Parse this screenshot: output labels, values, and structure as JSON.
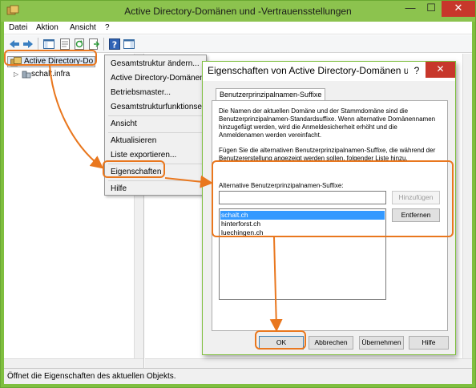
{
  "window": {
    "title": "Active Directory-Domänen und -Vertrauensstellungen",
    "min_glyph": "—",
    "max_glyph": "☐",
    "close_glyph": "✕"
  },
  "menubar": {
    "items": [
      "Datei",
      "Aktion",
      "Ansicht",
      "?"
    ]
  },
  "toolbar": {
    "icons": [
      "back-icon",
      "forward-icon",
      "show-hide-console-tree-icon",
      "properties-icon",
      "refresh-icon",
      "export-list-icon",
      "help-icon",
      "show-action-pane-icon"
    ]
  },
  "tree": {
    "root_label": "Active Directory-Do",
    "child_label": "schalt.infra",
    "expander_glyph": "▷"
  },
  "context_menu": {
    "items": [
      "Gesamtstruktur ändern...",
      "Active Directory-Domänencontroller",
      "Betriebsmaster...",
      "Gesamtstrukturfunktionsebene heraufstufen...",
      "Ansicht",
      "Aktualisieren",
      "Liste exportieren...",
      "Eigenschaften",
      "Hilfe"
    ]
  },
  "dialog": {
    "title": "Eigenschaften von Active Directory-Domänen u...",
    "help_glyph": "?",
    "close_glyph": "✕",
    "tab_label": "Benutzerprinzipalnamen-Suffixe",
    "description1": "Die Namen der aktuellen Domäne und der Stammdomäne sind die Benutzerprinzipalnamen-Standardsuffixe. Wenn alternative Domänennamen hinzugefügt werden, wird die Anmeldesicherheit erhöht und die Anmeldenamen werden vereinfacht.",
    "description2": "Fügen Sie die alternativen Benutzerprinzipalnamen-Suffixe, die während der Benutzererstellung angezeigt werden sollen, folgender Liste hinzu.",
    "field_label": "Alternative Benutzerprinzipalnamen-Suffixe:",
    "input_value": "",
    "suffixes": [
      "schalt.ch",
      "hinterforst.ch",
      "luechingen.ch"
    ],
    "selected_index": 0,
    "add_button": "Hinzufügen",
    "remove_button": "Entfernen",
    "ok_button": "OK",
    "cancel_button": "Abbrechen",
    "apply_button": "Übernehmen",
    "help_button": "Hilfe"
  },
  "statusbar": {
    "text": "Öffnet die Eigenschaften des aktuellen Objekts."
  },
  "colors": {
    "window_frame": "#8cc34e",
    "highlight": "#e9771e",
    "selection": "#3399ff",
    "close_button": "#c7372b"
  }
}
